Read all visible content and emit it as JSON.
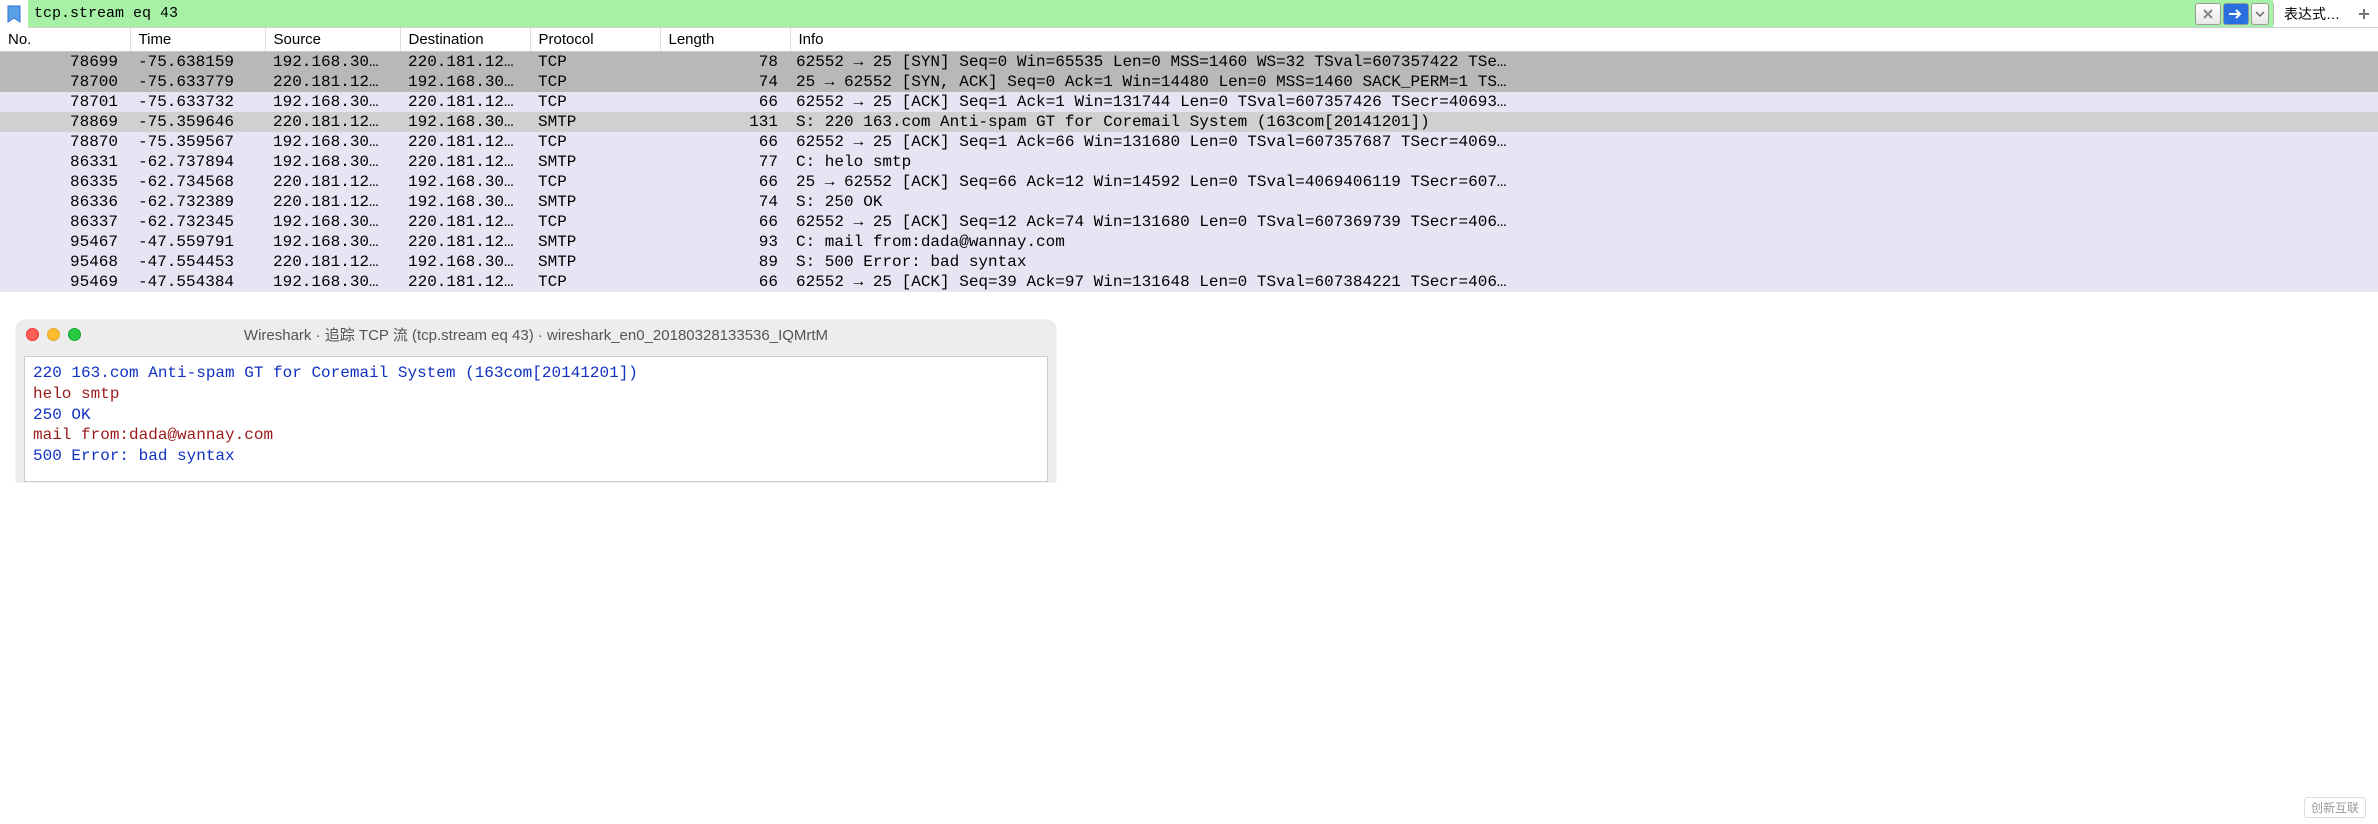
{
  "filter": {
    "value": "tcp.stream eq 43",
    "expression_label": "表达式…"
  },
  "columns": [
    "No.",
    "Time",
    "Source",
    "Destination",
    "Protocol",
    "Length",
    "Info"
  ],
  "packets": [
    {
      "no": "78699",
      "time": "-75.638159",
      "src": "192.168.30…",
      "dst": "220.181.12…",
      "proto": "TCP",
      "len": "78",
      "info": "62552 → 25 [SYN] Seq=0 Win=65535 Len=0 MSS=1460 WS=32 TSval=607357422 TSe…",
      "cls": "row-gray"
    },
    {
      "no": "78700",
      "time": "-75.633779",
      "src": "220.181.12…",
      "dst": "192.168.30…",
      "proto": "TCP",
      "len": "74",
      "info": "25 → 62552 [SYN, ACK] Seq=0 Ack=1 Win=14480 Len=0 MSS=1460 SACK_PERM=1 TS…",
      "cls": "row-gray"
    },
    {
      "no": "78701",
      "time": "-75.633732",
      "src": "192.168.30…",
      "dst": "220.181.12…",
      "proto": "TCP",
      "len": "66",
      "info": "62552 → 25 [ACK] Seq=1 Ack=1 Win=131744 Len=0 TSval=607357426 TSecr=40693…",
      "cls": "row-lav"
    },
    {
      "no": "78869",
      "time": "-75.359646",
      "src": "220.181.12…",
      "dst": "192.168.30…",
      "proto": "SMTP",
      "len": "131",
      "info": "S: 220 163.com Anti-spam GT for Coremail System (163com[20141201])",
      "cls": "row-sel"
    },
    {
      "no": "78870",
      "time": "-75.359567",
      "src": "192.168.30…",
      "dst": "220.181.12…",
      "proto": "TCP",
      "len": "66",
      "info": "62552 → 25 [ACK] Seq=1 Ack=66 Win=131680 Len=0 TSval=607357687 TSecr=4069…",
      "cls": "row-lav"
    },
    {
      "no": "86331",
      "time": "-62.737894",
      "src": "192.168.30…",
      "dst": "220.181.12…",
      "proto": "SMTP",
      "len": "77",
      "info": "C: helo smtp",
      "cls": "row-lav"
    },
    {
      "no": "86335",
      "time": "-62.734568",
      "src": "220.181.12…",
      "dst": "192.168.30…",
      "proto": "TCP",
      "len": "66",
      "info": "25 → 62552 [ACK] Seq=66 Ack=12 Win=14592 Len=0 TSval=4069406119 TSecr=607…",
      "cls": "row-lav"
    },
    {
      "no": "86336",
      "time": "-62.732389",
      "src": "220.181.12…",
      "dst": "192.168.30…",
      "proto": "SMTP",
      "len": "74",
      "info": "S: 250 OK",
      "cls": "row-lav"
    },
    {
      "no": "86337",
      "time": "-62.732345",
      "src": "192.168.30…",
      "dst": "220.181.12…",
      "proto": "TCP",
      "len": "66",
      "info": "62552 → 25 [ACK] Seq=12 Ack=74 Win=131680 Len=0 TSval=607369739 TSecr=406…",
      "cls": "row-lav"
    },
    {
      "no": "95467",
      "time": "-47.559791",
      "src": "192.168.30…",
      "dst": "220.181.12…",
      "proto": "SMTP",
      "len": "93",
      "info": "C: mail from:dada@wannay.com",
      "cls": "row-lav"
    },
    {
      "no": "95468",
      "time": "-47.554453",
      "src": "220.181.12…",
      "dst": "192.168.30…",
      "proto": "SMTP",
      "len": "89",
      "info": "S: 500 Error: bad syntax",
      "cls": "row-lav"
    },
    {
      "no": "95469",
      "time": "-47.554384",
      "src": "192.168.30…",
      "dst": "220.181.12…",
      "proto": "TCP",
      "len": "66",
      "info": "62552 → 25 [ACK] Seq=39 Ack=97 Win=131648 Len=0 TSval=607384221 TSecr=406…",
      "cls": "row-lav"
    }
  ],
  "follow_window": {
    "title": "Wireshark · 追踪 TCP 流 (tcp.stream eq 43) · wireshark_en0_20180328133536_IQMrtM",
    "lines": [
      {
        "text": "220 163.com Anti-spam GT for Coremail System (163com[20141201])",
        "side": "srv"
      },
      {
        "text": "helo smtp",
        "side": "cli"
      },
      {
        "text": "250 OK",
        "side": "srv"
      },
      {
        "text": "mail from:dada@wannay.com",
        "side": "cli"
      },
      {
        "text": "500 Error: bad syntax",
        "side": "srv"
      }
    ]
  },
  "watermark": "创新互联"
}
